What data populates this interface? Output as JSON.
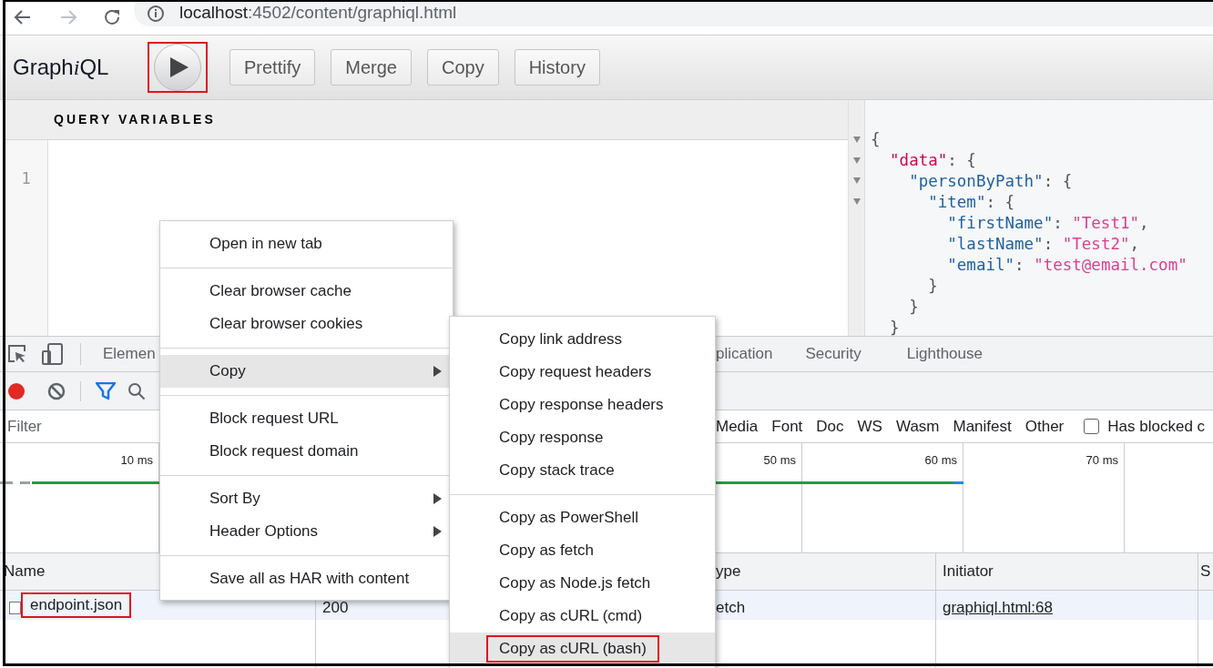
{
  "browser": {
    "url_host": "localhost",
    "url_path": ":4502/content/graphiql.html"
  },
  "graphiql": {
    "title_parts": [
      {
        "text": "Graph",
        "italic": false
      },
      {
        "text": "i",
        "italic": true
      },
      {
        "text": "QL",
        "italic": false
      }
    ],
    "run_button": {
      "annotated": true
    },
    "buttons": [
      "Prettify",
      "Merge",
      "Copy",
      "History"
    ],
    "variables": {
      "header": "QUERY VARIABLES",
      "line_numbers": [
        "1"
      ]
    },
    "result": {
      "lines": [
        {
          "foldable": true,
          "tokens": [
            {
              "kind": "punct",
              "text": "{"
            }
          ]
        },
        {
          "foldable": true,
          "tokens": [
            {
              "kind": "root_key",
              "text": "  \"data\""
            },
            {
              "kind": "punct",
              "text": ": {"
            }
          ]
        },
        {
          "foldable": true,
          "tokens": [
            {
              "kind": "key",
              "text": "    \"personByPath\""
            },
            {
              "kind": "punct",
              "text": ": {"
            }
          ]
        },
        {
          "foldable": true,
          "tokens": [
            {
              "kind": "key",
              "text": "      \"item\""
            },
            {
              "kind": "punct",
              "text": ": {"
            }
          ]
        },
        {
          "foldable": false,
          "tokens": [
            {
              "kind": "key",
              "text": "        \"firstName\""
            },
            {
              "kind": "punct",
              "text": ": "
            },
            {
              "kind": "string",
              "text": "\"Test1\""
            },
            {
              "kind": "punct",
              "text": ","
            }
          ]
        },
        {
          "foldable": false,
          "tokens": [
            {
              "kind": "key",
              "text": "        \"lastName\""
            },
            {
              "kind": "punct",
              "text": ": "
            },
            {
              "kind": "string",
              "text": "\"Test2\""
            },
            {
              "kind": "punct",
              "text": ","
            }
          ]
        },
        {
          "foldable": false,
          "tokens": [
            {
              "kind": "key",
              "text": "        \"email\""
            },
            {
              "kind": "punct",
              "text": ": "
            },
            {
              "kind": "string",
              "text": "\"test@email.com\""
            }
          ]
        },
        {
          "foldable": false,
          "tokens": [
            {
              "kind": "punct",
              "text": "      }"
            }
          ]
        },
        {
          "foldable": false,
          "tokens": [
            {
              "kind": "punct",
              "text": "    }"
            }
          ]
        },
        {
          "foldable": false,
          "tokens": [
            {
              "kind": "punct",
              "text": "  }"
            }
          ]
        }
      ]
    }
  },
  "devtools": {
    "tabs": [
      "Elemen",
      "plication",
      "Security",
      "Lighthouse"
    ],
    "filter": {
      "placeholder": "Filter"
    },
    "type_filters": [
      "Media",
      "Font",
      "Doc",
      "WS",
      "Wasm",
      "Manifest",
      "Other"
    ],
    "has_blocked": {
      "label": "Has blocked c",
      "checked": false
    },
    "timeline": {
      "ticks": [
        "10 ms",
        "50 ms",
        "60 ms",
        "70 ms"
      ]
    },
    "table": {
      "columns": [
        "Name",
        "",
        "ype",
        "Initiator",
        "S"
      ],
      "rows": [
        {
          "cells": [
            {
              "kind": "text",
              "text": "endpoint.json",
              "annotated": true
            },
            {
              "kind": "text",
              "text": "200",
              "annotated": false
            },
            {
              "kind": "text",
              "text": "etch",
              "annotated": false
            },
            {
              "kind": "link",
              "text": "graphiql.html:68",
              "annotated": false
            }
          ]
        }
      ]
    }
  },
  "context_menu": {
    "groups": [
      [
        {
          "label": "Open in new tab",
          "submenu": false,
          "selected": false
        }
      ],
      [
        {
          "label": "Clear browser cache",
          "submenu": false,
          "selected": false
        },
        {
          "label": "Clear browser cookies",
          "submenu": false,
          "selected": false
        }
      ],
      [
        {
          "label": "Copy",
          "submenu": true,
          "selected": true
        }
      ],
      [
        {
          "label": "Block request URL",
          "submenu": false,
          "selected": false
        },
        {
          "label": "Block request domain",
          "submenu": false,
          "selected": false
        }
      ],
      [
        {
          "label": "Sort By",
          "submenu": true,
          "selected": false
        },
        {
          "label": "Header Options",
          "submenu": true,
          "selected": false
        }
      ],
      [
        {
          "label": "Save all as HAR with content",
          "submenu": false,
          "selected": false
        }
      ]
    ]
  },
  "copy_submenu": {
    "groups": [
      [
        {
          "label": "Copy link address",
          "selected": false,
          "annotated": false
        },
        {
          "label": "Copy request headers",
          "selected": false,
          "annotated": false
        },
        {
          "label": "Copy response headers",
          "selected": false,
          "annotated": false
        },
        {
          "label": "Copy response",
          "selected": false,
          "annotated": false
        },
        {
          "label": "Copy stack trace",
          "selected": false,
          "annotated": false
        }
      ],
      [
        {
          "label": "Copy as PowerShell",
          "selected": false,
          "annotated": false
        },
        {
          "label": "Copy as fetch",
          "selected": false,
          "annotated": false
        },
        {
          "label": "Copy as Node.js fetch",
          "selected": false,
          "annotated": false
        },
        {
          "label": "Copy as cURL (cmd)",
          "selected": false,
          "annotated": false
        },
        {
          "label": "Copy as cURL (bash)",
          "selected": true,
          "annotated": true
        }
      ]
    ]
  }
}
